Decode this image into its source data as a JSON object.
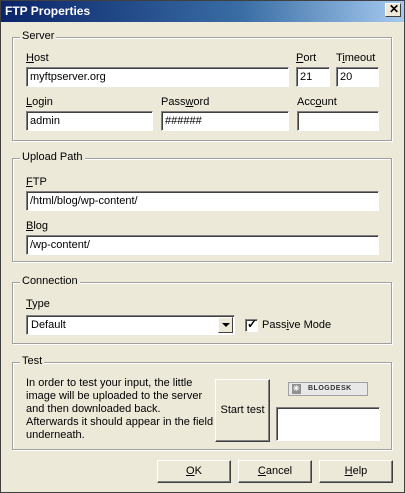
{
  "window": {
    "title": "FTP Properties",
    "close_glyph": "✕"
  },
  "server": {
    "legend": "Server",
    "host": {
      "label_prefix": "",
      "label_u": "H",
      "label_rest": "ost",
      "value": "myftpserver.org"
    },
    "port": {
      "label_u": "P",
      "label_rest": "ort",
      "value": "21"
    },
    "timeout": {
      "label_prefix": "T",
      "label_u": "i",
      "label_rest": "meout",
      "value": "20"
    },
    "login": {
      "label_u": "L",
      "label_rest": "ogin",
      "value": "admin"
    },
    "password": {
      "label_prefix": "Pass",
      "label_u": "w",
      "label_rest": "ord",
      "value": "######"
    },
    "account": {
      "label_prefix": "Acc",
      "label_u": "o",
      "label_rest": "unt",
      "value": ""
    }
  },
  "upload_path": {
    "legend": "Upload Path",
    "ftp": {
      "label_u": "F",
      "label_rest": "TP",
      "value": "/html/blog/wp-content/"
    },
    "blog": {
      "label_u": "B",
      "label_rest": "log",
      "value": "/wp-content/"
    }
  },
  "connection": {
    "legend": "Connection",
    "type": {
      "label_u": "T",
      "label_rest": "ype",
      "value": "Default"
    },
    "passive": {
      "label_prefix": "Pass",
      "label_u": "i",
      "label_rest": "ve Mode",
      "checked": true
    }
  },
  "test": {
    "legend": "Test",
    "lines": [
      "In order to test your input, the little",
      "image will be uploaded to the server",
      "and then downloaded back.",
      "Afterwards it should appear in the field",
      "underneath."
    ],
    "start_button": "Start test",
    "logo_text": "BLOGDESK"
  },
  "buttons": {
    "ok": {
      "u": "O",
      "rest": "K"
    },
    "cancel": {
      "prefix": "",
      "u": "C",
      "rest": "ancel"
    },
    "help": {
      "u": "H",
      "rest": "elp"
    }
  },
  "colors": {
    "face": "#ece9d8",
    "title_start": "#0a246a",
    "title_end": "#a6caf0"
  },
  "icons": {
    "close": "close-icon",
    "dropdown": "chevron-down-icon",
    "checkbox": "checkmark-icon",
    "logo": "blogdesk-logo-icon"
  }
}
